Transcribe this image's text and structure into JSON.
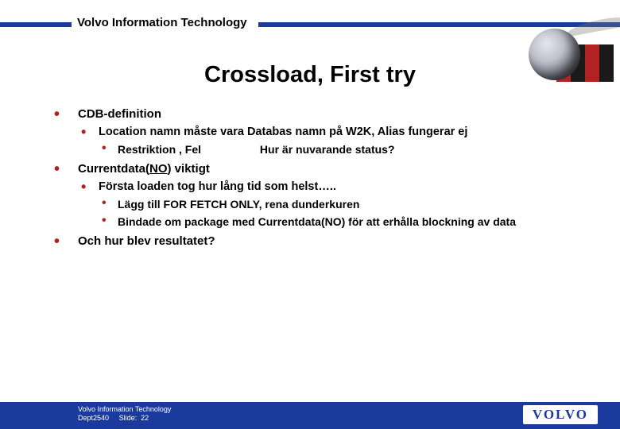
{
  "header": {
    "org": "Volvo Information Technology"
  },
  "slide": {
    "title": "Crossload, First try"
  },
  "bullets": {
    "b1": "CDB-definition",
    "b1_1": "Location namn måste vara Databas namn på W2K, Alias fungerar ej",
    "b1_1_1": "Restriktion , Fel",
    "b1_1_1r": "Hur är nuvarande status?",
    "b2_pre": "Currentdata(",
    "b2_no": "NO",
    "b2_post": ") viktigt",
    "b2_1": "Första loaden tog hur lång tid som helst…..",
    "b2_1_1": "Lägg till FOR FETCH ONLY, rena dunderkuren",
    "b2_1_2": "Bindade om package med Currentdata(NO) för att erhålla blockning av data",
    "b3": "Och hur blev resultatet?"
  },
  "footer": {
    "line1": "Volvo Information Technology",
    "dept_label": "Dept ",
    "dept": "2540",
    "slide_label": "Slide:",
    "slide_no": "22",
    "logo": "VOLVO"
  }
}
